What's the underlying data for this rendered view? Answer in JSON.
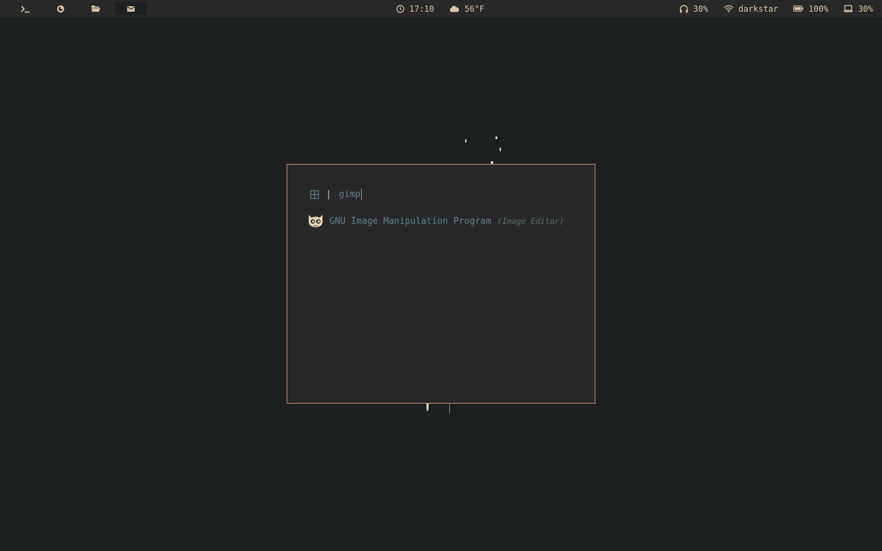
{
  "topbar": {
    "workspaces": [
      {
        "icon": "terminal-icon",
        "active": false
      },
      {
        "icon": "browser-icon",
        "active": false
      },
      {
        "icon": "folder-icon",
        "active": false
      },
      {
        "icon": "mail-icon",
        "active": true
      }
    ],
    "clock": {
      "icon": "clock-icon",
      "time": "17:10"
    },
    "weather": {
      "icon": "cloud-icon",
      "temp": "56°F"
    },
    "volume": {
      "icon": "headphones-icon",
      "value": "30%"
    },
    "network": {
      "icon": "wifi-icon",
      "ssid": "darkstar"
    },
    "battery": {
      "icon": "battery-icon",
      "value": "100%"
    },
    "brightness": {
      "icon": "laptop-icon",
      "value": "30%"
    }
  },
  "launcher": {
    "mode_icon": "grid-icon",
    "separator": "|",
    "query": "gimp",
    "results": [
      {
        "icon": "gimp-icon",
        "name": "GNU Image Manipulation Program",
        "generic": "(Image Editor)"
      }
    ]
  },
  "colors": {
    "background": "#1d2021",
    "bar": "#282828",
    "foreground": "#d8c3a5",
    "accent_border": "#c98e7a",
    "match_text": "#62818a"
  }
}
